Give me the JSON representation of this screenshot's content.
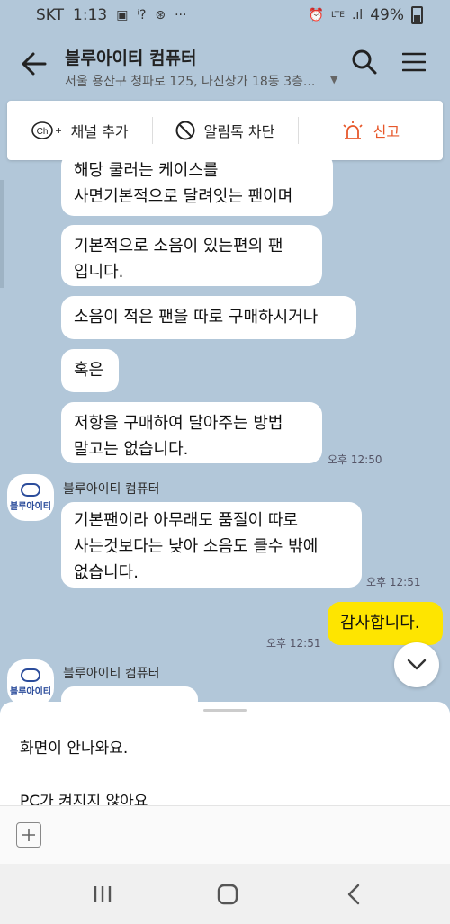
{
  "status_bar": {
    "carrier": "SKT",
    "time": "1:13",
    "battery": "49%",
    "lte": "LTE"
  },
  "header": {
    "title": "블루아이티 컴퓨터",
    "subtitle": "서울 용산구 청파로 125, 나진상가 18동 3층..."
  },
  "actions": {
    "add_channel": "채널 추가",
    "block": "알림톡 차단",
    "report": "신고"
  },
  "messages": {
    "m1": [
      "해당 쿨러는 케이스를",
      "사면기본적으로 달려잇는 팬이며"
    ],
    "m2": [
      "기본적으로 소음이 있는편의 팬",
      "입니다."
    ],
    "m3": "소음이 적은 팬을 따로 구매하시거나",
    "m4": "혹은",
    "m5": [
      "저항을 구매하여 달아주는 방법",
      "말고는 없습니다."
    ],
    "t1": "오후 12:50",
    "sender": "블루아이티 컴퓨터",
    "avatar_label": "블루아이티",
    "m6": [
      "기본팬이라 아무래도 품질이 따로",
      "사는것보다는 낮아 소음도 클수 밖에",
      "없습니다."
    ],
    "t2": "오후 12:51",
    "mine": "감사합니다.",
    "t3": "오후 12:51"
  },
  "quick_replies": [
    "화면이 안나와요.",
    "PC가 켜지지 않아요"
  ]
}
